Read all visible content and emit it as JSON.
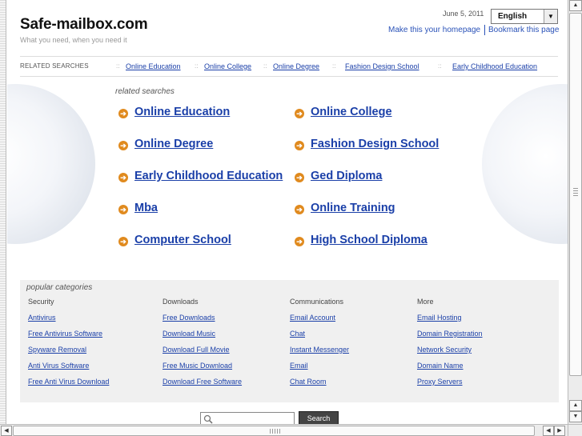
{
  "header": {
    "site_title": "Safe-mailbox.com",
    "tagline": "What you need, when you need it",
    "date": "June 5, 2011",
    "language": "English",
    "homepage_link": "Make this your homepage",
    "bookmark_link": "Bookmark this page"
  },
  "related_bar": {
    "label": "RELATED SEARCHES",
    "separator": "::",
    "links": [
      "Online Education",
      "Online College",
      "Online Degree",
      "Fashion Design School",
      "Early Childhood Education"
    ]
  },
  "main": {
    "heading": "related searches",
    "bullet_icon": "arrow-right-circle-icon",
    "bullet_color": "#e08a1e",
    "left_column": [
      "Online Education",
      "Online Degree",
      "Early Childhood Education",
      "Mba",
      "Computer School"
    ],
    "right_column": [
      "Online College",
      "Fashion Design School",
      "Ged Diploma",
      "Online Training",
      "High School Diploma"
    ]
  },
  "popular": {
    "heading": "popular categories",
    "columns": [
      {
        "title": "Security",
        "links": [
          "Antivirus",
          "Free Antivirus Software",
          "Spyware Removal",
          "Anti Virus Software",
          "Free Anti Virus Download"
        ]
      },
      {
        "title": "Downloads",
        "links": [
          "Free Downloads",
          "Download Music",
          "Download Full Movie",
          "Free Music Download",
          "Download Free Software"
        ]
      },
      {
        "title": "Communications",
        "links": [
          "Email Account",
          "Chat",
          "Instant Messenger",
          "Email",
          "Chat Room"
        ]
      },
      {
        "title": "More",
        "links": [
          "Email Hosting",
          "Domain Registration",
          "Network Security",
          "Domain Name",
          "Proxy Servers"
        ]
      }
    ]
  },
  "search": {
    "button_label": "Search",
    "value": ""
  },
  "colors": {
    "link": "#1a3fa8",
    "panel": "#f0f0f0"
  }
}
